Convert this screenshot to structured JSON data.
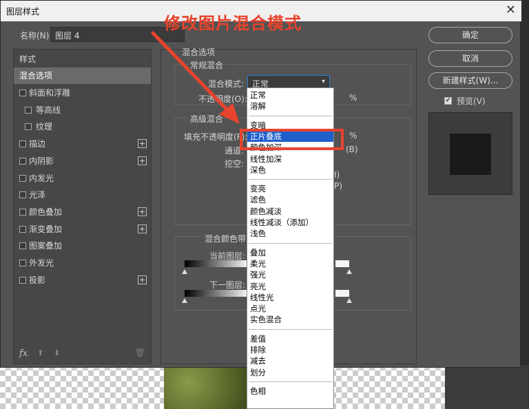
{
  "annotation": {
    "text": "修改图片混合模式"
  },
  "dialog": {
    "title": "图层样式",
    "close_glyph": "✕",
    "name_label": "名称(N):",
    "name_value": "图层 4"
  },
  "left_panel": {
    "header": "样式",
    "selected": "混合选项",
    "items": [
      {
        "label": "斜面和浮雕",
        "plus": false
      },
      {
        "label": "等高线",
        "plus": false
      },
      {
        "label": "纹理",
        "plus": false
      },
      {
        "label": "描边",
        "plus": true
      },
      {
        "label": "内阴影",
        "plus": true
      },
      {
        "label": "内发光",
        "plus": false
      },
      {
        "label": "光泽",
        "plus": false
      },
      {
        "label": "颜色叠加",
        "plus": true
      },
      {
        "label": "渐变叠加",
        "plus": true
      },
      {
        "label": "图案叠加",
        "plus": false
      },
      {
        "label": "外发光",
        "plus": false
      },
      {
        "label": "投影",
        "plus": true
      }
    ],
    "footer": {
      "fx": "fx",
      "fx_dot": ".",
      "up": "⬆",
      "down": "⬇",
      "trash": "🗑"
    }
  },
  "blend": {
    "section_title": "混合选项",
    "normal_group": "常规混合",
    "mode_label": "混合模式:",
    "mode_value": "正常",
    "opacity_label": "不透明度(O):",
    "pct": "%",
    "advanced_group": "高级混合",
    "fill_label": "填充不透明度(F):",
    "channel_label": "通道:",
    "channel_tail": "(B)",
    "knockout_label": "挖空:",
    "paren_i": "I)",
    "paren_p": "P)",
    "blend_if_label": "混合颜色带:",
    "current_layer": "当前图层:",
    "underlying_layer": "下一图层:"
  },
  "dropdown": {
    "groups": [
      [
        "正常",
        "溶解"
      ],
      [
        "变暗",
        "正片叠底",
        "颜色加深",
        "线性加深",
        "深色"
      ],
      [
        "变亮",
        "滤色",
        "颜色减淡",
        "线性减淡（添加）",
        "浅色"
      ],
      [
        "叠加",
        "柔光",
        "强光",
        "亮光",
        "线性光",
        "点光",
        "实色混合"
      ],
      [
        "差值",
        "排除",
        "减去",
        "划分"
      ],
      [
        "色相"
      ]
    ],
    "highlighted": "正片叠底"
  },
  "buttons": {
    "ok": "确定",
    "cancel": "取消",
    "new_style": "新建样式(W)...",
    "preview": "预览(V)",
    "check": "✔"
  },
  "colors": {
    "annotation": "#e8432c",
    "highlight": "#1e5fcc",
    "dialog_bg": "#535353"
  }
}
